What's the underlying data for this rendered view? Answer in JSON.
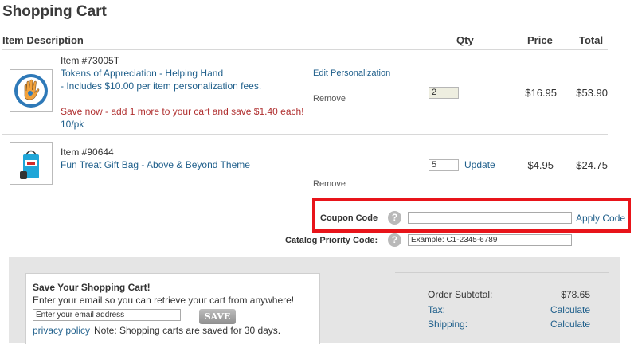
{
  "page": {
    "title": "Shopping Cart"
  },
  "headers": {
    "item": "Item Description",
    "qty": "Qty",
    "price": "Price",
    "total": "Total"
  },
  "items": [
    {
      "number": "Item #73005T",
      "name": "Tokens of Appreciation - Helping Hand",
      "fee_note": "- Includes $10.00 per item personalization fees.",
      "edit_label": "Edit Personalization",
      "remove_label": "Remove",
      "promo": "Save now - add 1 more to your cart and save $1.40 each!",
      "pack": "10/pk",
      "qty": "2",
      "price": "$16.95",
      "total": "$53.90"
    },
    {
      "number": "Item #90644",
      "name": "Fun Treat Gift Bag - Above & Beyond Theme",
      "remove_label": "Remove",
      "update_label": "Update",
      "qty": "5",
      "price": "$4.95",
      "total": "$24.75"
    }
  ],
  "coupon": {
    "label": "Coupon Code",
    "help": "?",
    "apply_label": "Apply Code",
    "value": ""
  },
  "catalog": {
    "label": "Catalog Priority Code:",
    "help": "?",
    "placeholder": "Example: C1-2345-6789"
  },
  "save_cart": {
    "title": "Save Your Shopping Cart!",
    "description": "Enter your email so you can retrieve your cart from anywhere!",
    "email_placeholder": "Enter your email address",
    "save_button": "SAVE",
    "privacy_link": "privacy policy",
    "note": "Note: Shopping carts are saved for 30 days."
  },
  "summary": {
    "subtotal_label": "Order Subtotal:",
    "subtotal_value": "$78.65",
    "tax_label": "Tax:",
    "tax_action": "Calculate",
    "shipping_label": "Shipping:",
    "shipping_action": "Calculate"
  },
  "colors": {
    "link": "#1f5f8b",
    "promo": "#b03030",
    "highlight": "#e8141a",
    "panel": "#e5e5e5"
  }
}
